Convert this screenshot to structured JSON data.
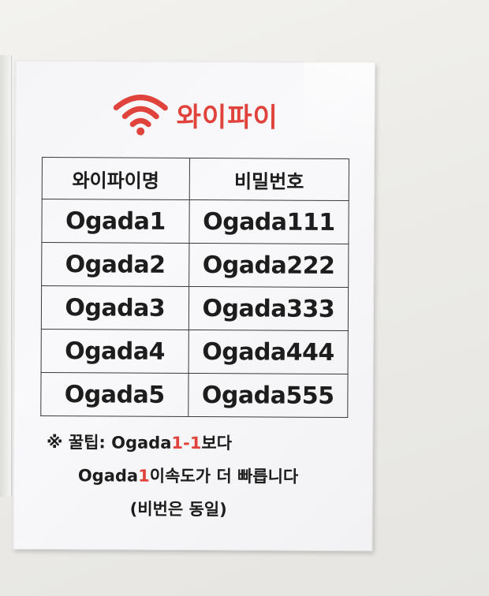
{
  "sign": {
    "title": "와이파이",
    "icon": "wifi-icon",
    "accent_color": "#e0433b",
    "table": {
      "headers": [
        "와이파이명",
        "비밀번호"
      ],
      "rows": [
        [
          "Ogada1",
          "Ogada111"
        ],
        [
          "Ogada2",
          "Ogada222"
        ],
        [
          "Ogada3",
          "Ogada333"
        ],
        [
          "Ogada4",
          "Ogada444"
        ],
        [
          "Ogada5",
          "Ogada555"
        ]
      ]
    },
    "tip": {
      "line1_prefix": "※ 꿀팁: Ogada",
      "line1_red": "1-1",
      "line1_suffix": "보다",
      "line2_prefix": "Ogada",
      "line2_red": "1",
      "line2_suffix": "이속도가 더 빠릅니다",
      "line3": "(비번은 동일)"
    }
  }
}
